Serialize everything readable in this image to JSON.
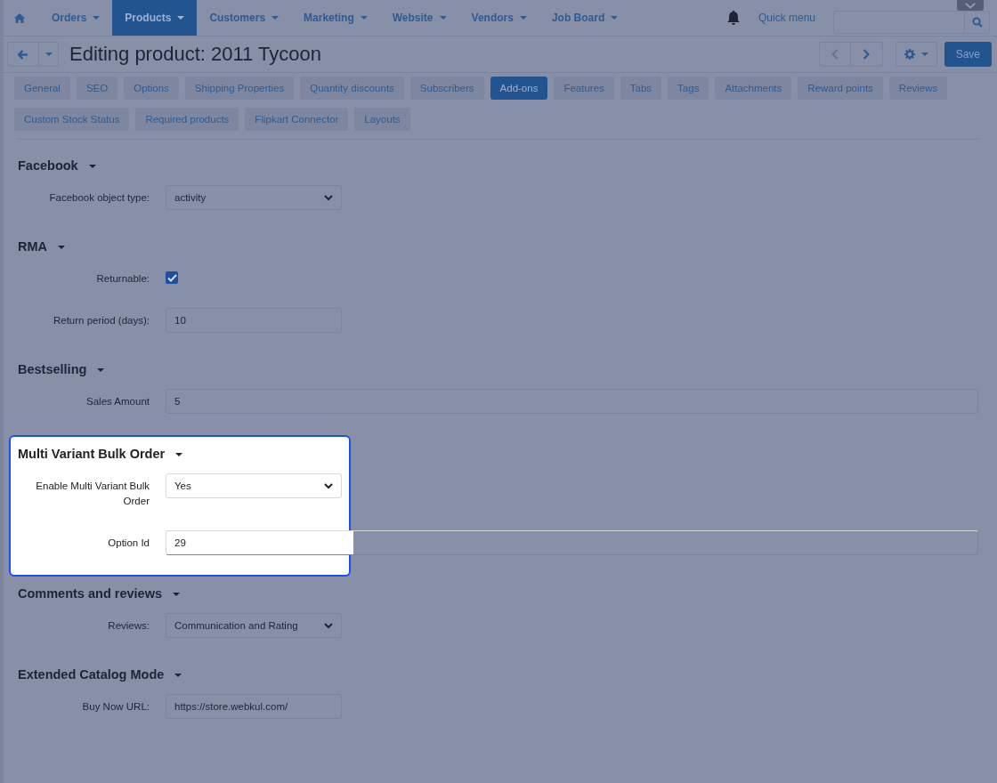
{
  "nav": {
    "items": [
      {
        "label": "Orders",
        "selected": false
      },
      {
        "label": "Products",
        "selected": true
      },
      {
        "label": "Customers",
        "selected": false
      },
      {
        "label": "Marketing",
        "selected": false
      },
      {
        "label": "Website",
        "selected": false
      },
      {
        "label": "Vendors",
        "selected": false
      },
      {
        "label": "Job Board",
        "selected": false
      }
    ],
    "quick_menu": "Quick menu"
  },
  "header": {
    "title": "Editing product: 2011 Tycoon",
    "save": "Save"
  },
  "tab_rows": [
    [
      {
        "label": "General",
        "selected": false
      },
      {
        "label": "SEO",
        "selected": false
      },
      {
        "label": "Options",
        "selected": false
      },
      {
        "label": "Shipping Properties",
        "selected": false
      },
      {
        "label": "Quantity discounts",
        "selected": false
      },
      {
        "label": "Subscribers",
        "selected": false
      },
      {
        "label": "Add-ons",
        "selected": true
      },
      {
        "label": "Features",
        "selected": false
      },
      {
        "label": "Tabs",
        "selected": false
      },
      {
        "label": "Tags",
        "selected": false
      },
      {
        "label": "Attachments",
        "selected": false
      },
      {
        "label": "Reward points",
        "selected": false
      },
      {
        "label": "Reviews",
        "selected": false
      }
    ],
    [
      {
        "label": "Custom Stock Status",
        "selected": false
      },
      {
        "label": "Required products",
        "selected": false
      },
      {
        "label": "Flipkart Connector",
        "selected": false
      },
      {
        "label": "Layouts",
        "selected": false
      }
    ]
  ],
  "sections": [
    {
      "title": "Facebook",
      "highlighted": false,
      "fields": [
        {
          "kind": "select",
          "label": "Facebook object type:",
          "value": "activity"
        }
      ]
    },
    {
      "title": "RMA",
      "highlighted": false,
      "fields": [
        {
          "kind": "checkbox",
          "label": "Returnable:",
          "checked": true
        },
        {
          "kind": "input",
          "label": "Return period (days):",
          "value": "10"
        }
      ]
    },
    {
      "title": "Bestselling",
      "highlighted": false,
      "fields": [
        {
          "kind": "wide_input",
          "label": "Sales Amount",
          "value": "5"
        }
      ]
    },
    {
      "title": "Multi Variant Bulk Order",
      "highlighted": true,
      "fields": [
        {
          "kind": "select",
          "label": "Enable Multi Variant Bulk Order",
          "value": "Yes"
        },
        {
          "kind": "wide_input",
          "label": "Option Id",
          "value": "29"
        }
      ]
    },
    {
      "title": "Comments and reviews",
      "highlighted": false,
      "fields": [
        {
          "kind": "select",
          "label": "Reviews:",
          "value": "Communication and Rating"
        }
      ]
    },
    {
      "title": "Extended Catalog Mode",
      "highlighted": false,
      "fields": [
        {
          "kind": "input",
          "label": "Buy Now URL:",
          "value": "https://store.webkul.com/"
        }
      ]
    }
  ]
}
